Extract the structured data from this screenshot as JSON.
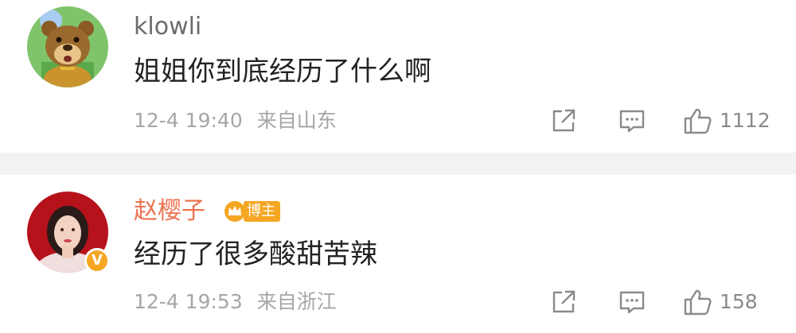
{
  "comments": [
    {
      "username": "klowli",
      "content": "姐姐你到底经历了什么啊",
      "time": "12-4 19:40",
      "location": "来自山东",
      "likes": "1112",
      "avatar_icon": "cartoon-bear-avatar"
    },
    {
      "username": "赵樱子",
      "badge": "博主",
      "verified_mark": "V",
      "content": "经历了很多酸甜苦辣",
      "time": "12-4 19:53",
      "location": "来自浙江",
      "likes": "158",
      "avatar_icon": "user-photo-avatar"
    }
  ],
  "colors": {
    "username_default": "#6b6b6b",
    "username_author": "#eb7350",
    "badge": "#f5a623",
    "meta": "#a6a6a6",
    "divider": "#f2f2f2"
  }
}
